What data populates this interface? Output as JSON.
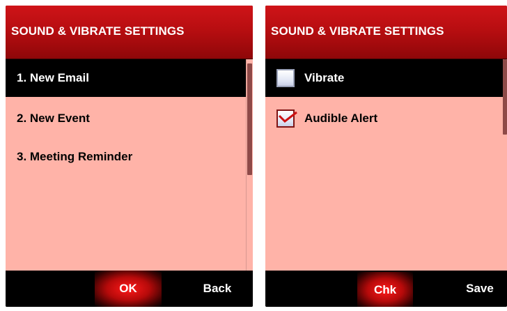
{
  "left_screen": {
    "title": "SOUND & VIBRATE SETTINGS",
    "items": [
      {
        "label": "1. New Email",
        "selected": true
      },
      {
        "label": "2. New Event",
        "selected": false
      },
      {
        "label": "3. Meeting Reminder",
        "selected": false
      }
    ],
    "softkeys": {
      "center": "OK",
      "right": "Back"
    }
  },
  "right_screen": {
    "title": "SOUND & VIBRATE SETTINGS",
    "options": [
      {
        "label": "Vibrate",
        "checked": false,
        "selected": true
      },
      {
        "label": "Audible Alert",
        "checked": true,
        "selected": false
      }
    ],
    "softkeys": {
      "center": "Chk",
      "right": "Save"
    }
  },
  "colors": {
    "title_bar": "#b50d10",
    "list_background": "#ffb3a8",
    "selected_row": "#000000",
    "scroll_thumb": "#8e4a48",
    "check_mark": "#cc1111"
  },
  "icons": {
    "checkbox_unchecked": "checkbox-unchecked-icon",
    "checkbox_checked": "checkbox-checked-icon"
  }
}
